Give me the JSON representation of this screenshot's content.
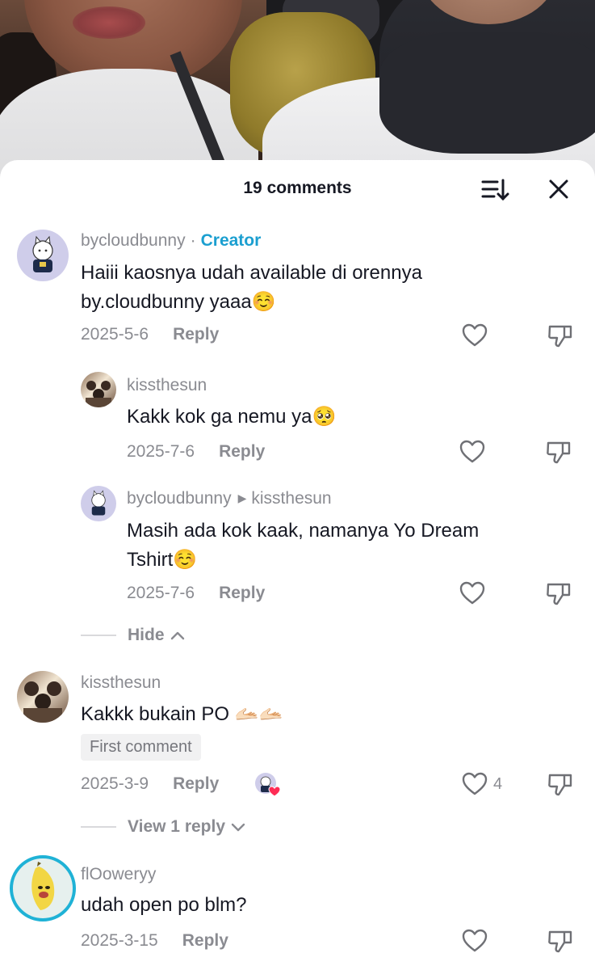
{
  "header": {
    "title": "19 comments"
  },
  "comments": [
    {
      "user": "bycloudbunny",
      "badge": "Creator",
      "text_line1": "Haiii kaosnya udah available di orennya",
      "text_line2": "by.cloudbunny yaaa☺️",
      "date": "2025-5-6",
      "reply_label": "Reply"
    },
    {
      "user": "kissthesun",
      "text": "Kakk kok ga nemu ya🥺",
      "date": "2025-7-6",
      "reply_label": "Reply"
    },
    {
      "user": "bycloudbunny",
      "reply_to": "kissthesun",
      "text_line1": "Masih ada kok kaak, namanya Yo Dream",
      "text_line2": "Tshirt☺️",
      "date": "2025-7-6",
      "reply_label": "Reply"
    },
    {
      "user": "kissthesun",
      "text": "Kakkk bukain PO 🫴🏻🫴🏻",
      "pill": "First comment",
      "date": "2025-3-9",
      "reply_label": "Reply",
      "likes": "4"
    },
    {
      "user": "flOoweryy",
      "text": "udah open po blm?",
      "date": "2025-3-15",
      "reply_label": "Reply"
    }
  ],
  "threads": {
    "hide_label": "Hide",
    "view_replies_label": "View 1 reply"
  },
  "icons": {
    "sort": "sort-icon",
    "close": "close-icon",
    "like": "heart-outline-icon",
    "dislike": "thumbs-down-icon",
    "chevron_up": "chevron-up-icon",
    "chevron_down": "chevron-down-icon",
    "creator_liked": "red-heart-icon"
  },
  "colors": {
    "creator_badge": "#1b9fd0",
    "secondary_text": "#8a8b91",
    "primary_text": "#161823",
    "verified_ring": "#1fb2d6"
  }
}
